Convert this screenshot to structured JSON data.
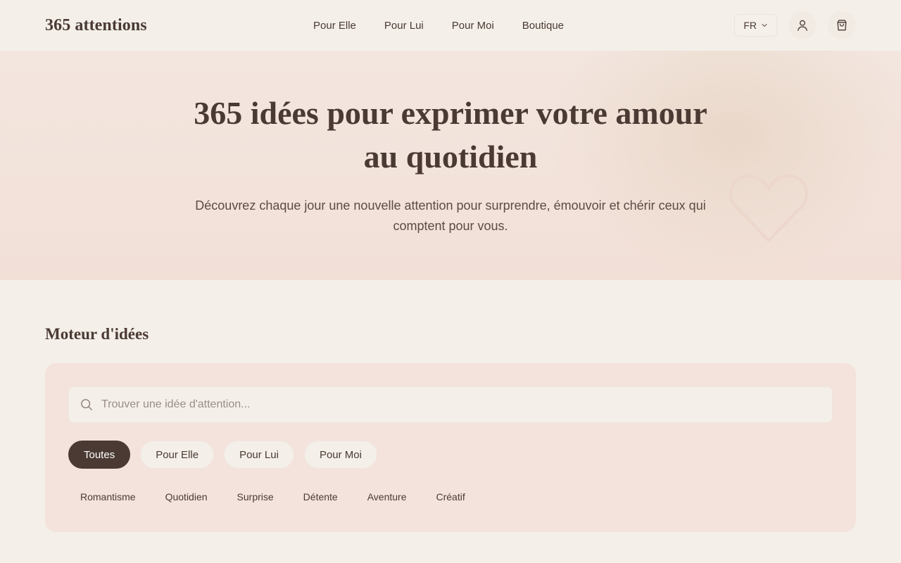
{
  "header": {
    "logo": "365 attentions",
    "nav": [
      "Pour Elle",
      "Pour Lui",
      "Pour Moi",
      "Boutique"
    ],
    "language": "FR",
    "icons": {
      "language_dropdown": "chevron-down-icon",
      "account": "user-icon",
      "cart": "shopping-bag-icon"
    }
  },
  "hero": {
    "title_line1": "365 idées pour exprimer votre amour",
    "title_line2": "au quotidien",
    "subtitle_line1": "Découvrez chaque jour une nouvelle attention pour surprendre, émouvoir et chérir ceux qui",
    "subtitle_line2": "comptent pour vous.",
    "decoration": "heart-icon"
  },
  "ideas": {
    "title": "Moteur d'idées",
    "search": {
      "placeholder": "Trouver une idée d'attention...",
      "value": "",
      "icon": "search-icon"
    },
    "audience_filters": [
      {
        "label": "Toutes",
        "active": true
      },
      {
        "label": "Pour Elle",
        "active": false
      },
      {
        "label": "Pour Lui",
        "active": false
      },
      {
        "label": "Pour Moi",
        "active": false
      }
    ],
    "categories": [
      "Romantisme",
      "Quotidien",
      "Surprise",
      "Détente",
      "Aventure",
      "Créatif"
    ]
  },
  "colors": {
    "text_primary": "#4a3a33",
    "page_background": "#f4efe9",
    "hero_background": "#f2e2da",
    "panel_background": "#f4e3dc",
    "active_pill": "#4a3a33",
    "heart_outline": "#edd6cc"
  }
}
